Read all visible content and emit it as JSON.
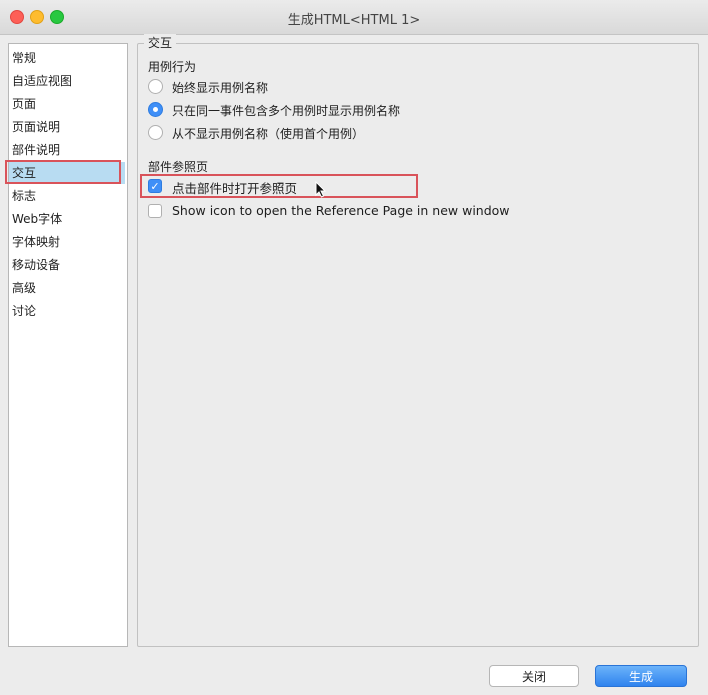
{
  "window": {
    "title": "生成HTML<HTML 1>"
  },
  "sidebar": {
    "items": [
      {
        "label": "常规"
      },
      {
        "label": "自适应视图"
      },
      {
        "label": "页面"
      },
      {
        "label": "页面说明"
      },
      {
        "label": "部件说明"
      },
      {
        "label": "交互",
        "selected": true
      },
      {
        "label": "标志"
      },
      {
        "label": "Web字体"
      },
      {
        "label": "字体映射"
      },
      {
        "label": "移动设备"
      },
      {
        "label": "高级"
      },
      {
        "label": "讨论"
      }
    ]
  },
  "panel": {
    "group_title": "交互",
    "case_behavior": {
      "heading": "用例行为",
      "options": [
        {
          "label": "始终显示用例名称",
          "selected": false
        },
        {
          "label": "只在同一事件包含多个用例时显示用例名称",
          "selected": true
        },
        {
          "label": "从不显示用例名称（使用首个用例）",
          "selected": false
        }
      ]
    },
    "reference_page": {
      "heading": "部件参照页",
      "options": [
        {
          "label": "点击部件时打开参照页",
          "checked": true
        },
        {
          "label": "Show icon to open the Reference Page in new window",
          "checked": false
        }
      ]
    }
  },
  "footer": {
    "close_label": "关闭",
    "generate_label": "生成"
  },
  "colors": {
    "accent": "#3f8ff7",
    "highlight": "#d9535a",
    "selection": "#b8dcf2"
  }
}
